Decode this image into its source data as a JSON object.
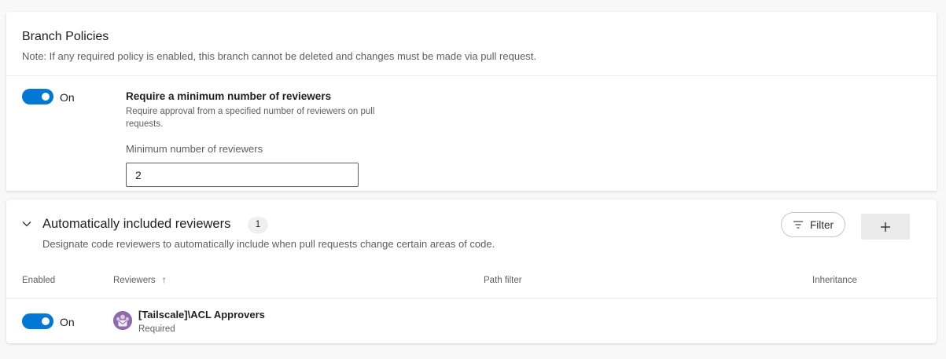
{
  "branch_policies": {
    "title": "Branch Policies",
    "note": "Note: If any required policy is enabled, this branch cannot be deleted and changes must be made via pull request.",
    "policy": {
      "toggle_state": "On",
      "title": "Require a minimum number of reviewers",
      "description": "Require approval from a specified number of reviewers on pull requests.",
      "field_label": "Minimum number of reviewers",
      "field_value": "2"
    }
  },
  "auto_reviewers": {
    "title": "Automatically included reviewers",
    "count": "1",
    "description": "Designate code reviewers to automatically include when pull requests change certain areas of code.",
    "filter_label": "Filter",
    "add_label": "+",
    "columns": {
      "enabled": "Enabled",
      "reviewers": "Reviewers",
      "reviewers_sort": "↑",
      "path_filter": "Path filter",
      "inheritance": "Inheritance"
    },
    "rows": [
      {
        "toggle_state": "On",
        "reviewer": "[Tailscale]\\ACL Approvers",
        "requirement": "Required",
        "path_filter": "",
        "inheritance": ""
      }
    ]
  },
  "colors": {
    "accent": "#0078d4",
    "avatar": "#8e6aa8",
    "secondary_text": "#605e5c"
  },
  "icons": [
    "chevron-down-icon",
    "filter-icon",
    "add-icon",
    "group-avatar-icon",
    "sort-ascending-icon"
  ]
}
